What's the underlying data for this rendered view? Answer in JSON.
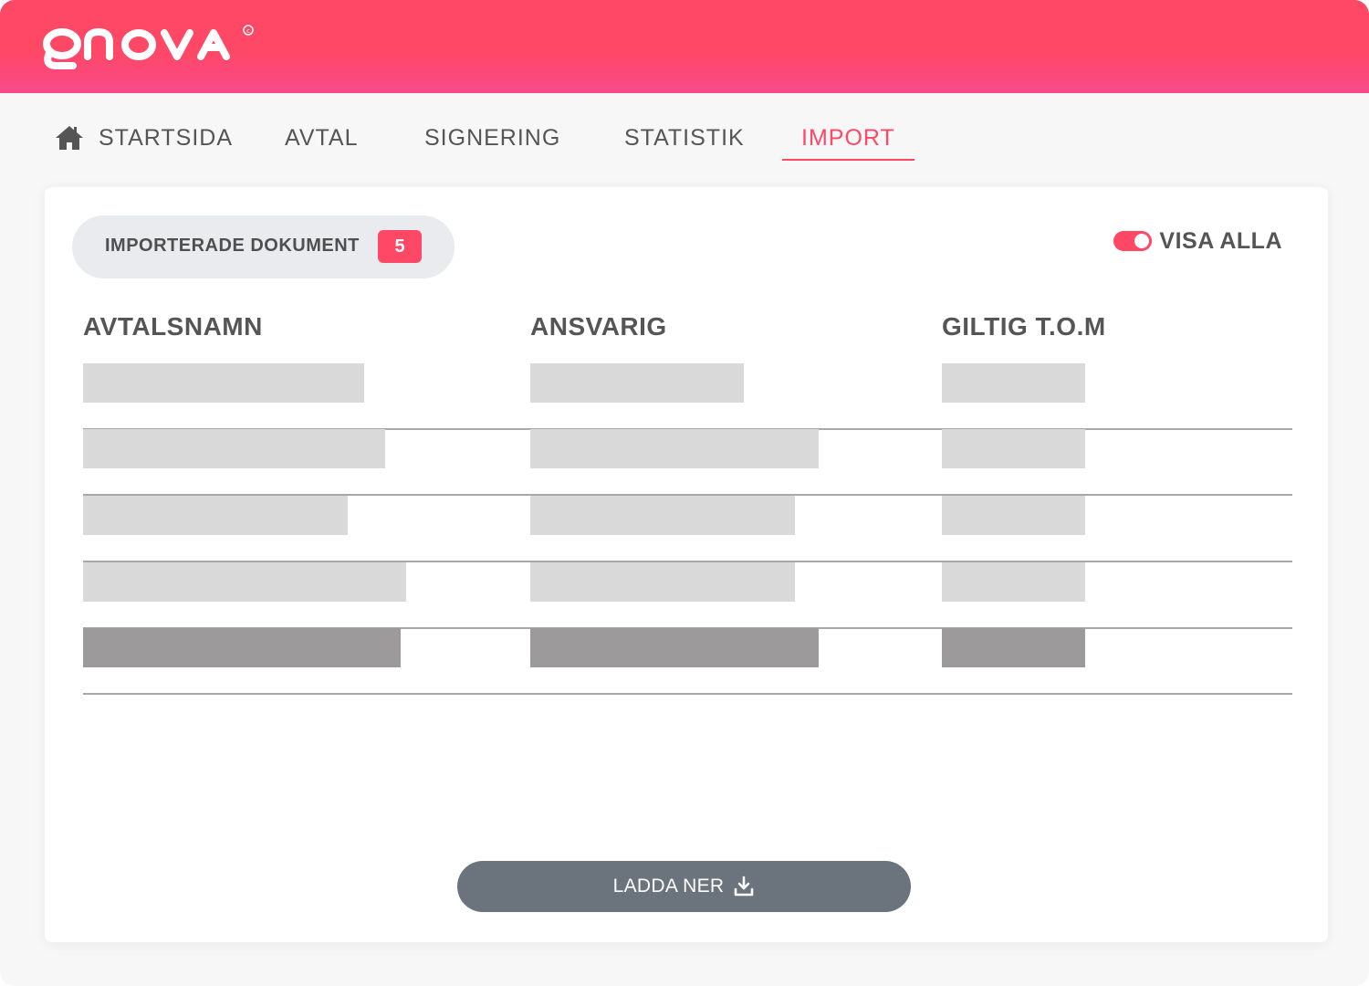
{
  "brand": {
    "logo_text": "qnova"
  },
  "nav": {
    "items": [
      {
        "label": "STARTSIDA",
        "icon": "home-icon"
      },
      {
        "label": "AVTAL"
      },
      {
        "label": "SIGNERING"
      },
      {
        "label": "STATISTIK"
      },
      {
        "label": "IMPORT"
      }
    ],
    "active": "IMPORT"
  },
  "card": {
    "pill_label": "IMPORTERADE DOKUMENT",
    "pill_count": "5",
    "toggle_label": "VISA ALLA",
    "toggle_on": true,
    "columns": [
      "AVTALSNAMN",
      "ANSVARIG",
      "GILTIG T.O.M"
    ],
    "rows_placeholder_count": 5,
    "download_label": "LADDA NER"
  },
  "colors": {
    "brand": "#ff4766",
    "placeholder": "#d9d9d9",
    "placeholder_selected": "#9c9a9b",
    "button": "#6b737c"
  }
}
